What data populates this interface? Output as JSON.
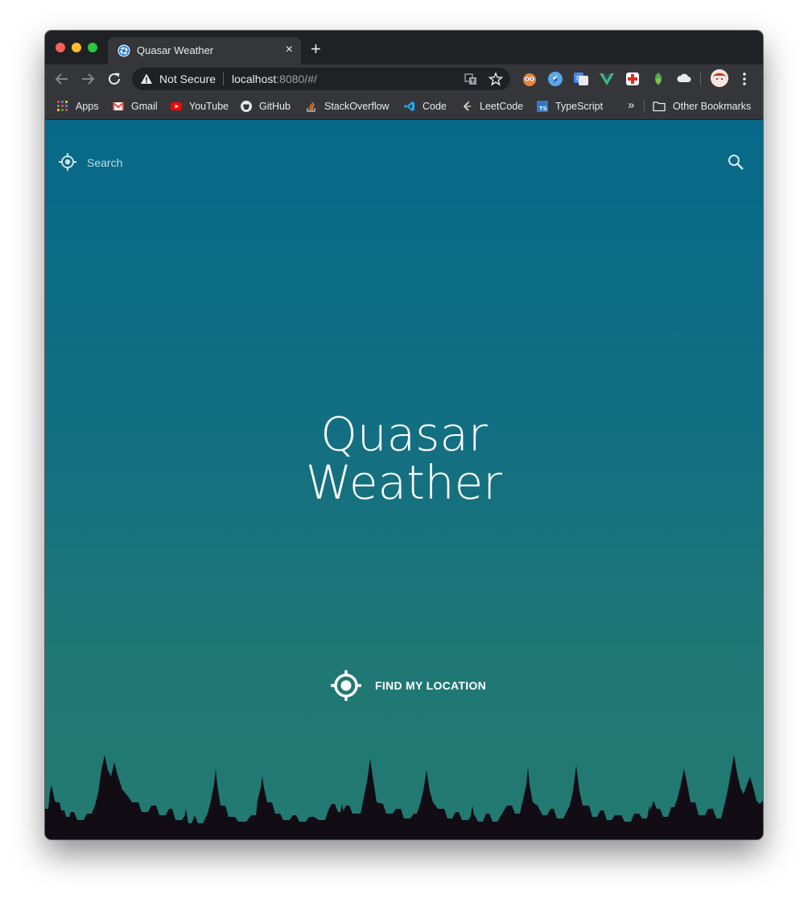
{
  "browser": {
    "tab": {
      "title": "Quasar Weather"
    },
    "new_tab_label": "+",
    "close_tab_label": "×",
    "omnibox": {
      "security_label": "Not Secure",
      "url_host": "localhost",
      "url_rest": ":8080/#/"
    },
    "bookmarks": [
      {
        "label": "Apps",
        "icon": "apps-grid-icon"
      },
      {
        "label": "Gmail",
        "icon": "gmail-icon"
      },
      {
        "label": "YouTube",
        "icon": "youtube-icon"
      },
      {
        "label": "GitHub",
        "icon": "github-icon"
      },
      {
        "label": "StackOverflow",
        "icon": "stackoverflow-icon"
      },
      {
        "label": "Code",
        "icon": "vscode-icon"
      },
      {
        "label": "LeetCode",
        "icon": "leetcode-icon"
      },
      {
        "label": "TypeScript",
        "icon": "typescript-icon"
      }
    ],
    "overflow_label": "»",
    "other_bookmarks": "Other Bookmarks"
  },
  "app": {
    "search_placeholder": "Search",
    "title_line1": "Quasar",
    "title_line2": "Weather",
    "find_location_label": "FIND MY LOCATION"
  },
  "colors": {
    "bg_top": "#066989",
    "bg_bottom": "#237a72",
    "skyline": "#120d14",
    "chrome_dark": "#202124",
    "chrome_mid": "#35363a"
  }
}
